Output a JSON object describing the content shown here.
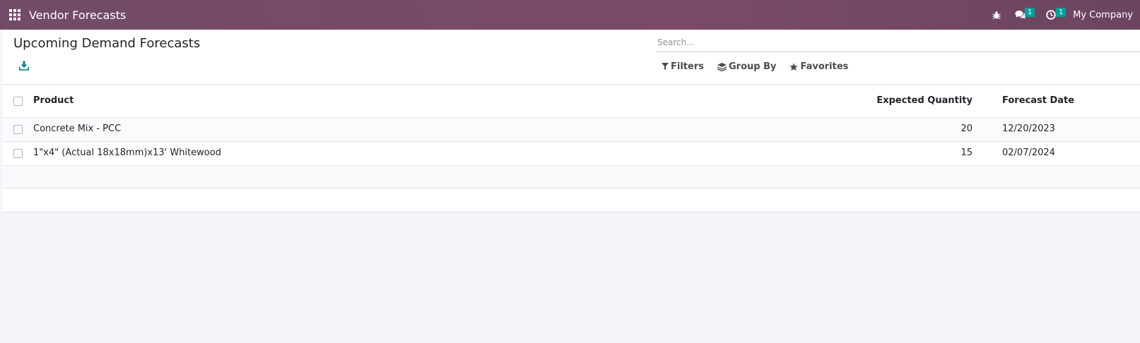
{
  "navbar": {
    "app_title": "Vendor Forecasts",
    "messages_count": "1",
    "activities_count": "1",
    "company": "My Company",
    "accent_color": "#714b67",
    "icons": [
      "apps-grid-icon",
      "bug-icon",
      "chat-icon",
      "clock-icon"
    ]
  },
  "page": {
    "title": "Upcoming Demand Forecasts",
    "download_icon": "download-icon"
  },
  "search": {
    "placeholder": "Search...",
    "value": ""
  },
  "filters": {
    "filters_label": "Filters",
    "group_by_label": "Group By",
    "favorites_label": "Favorites"
  },
  "table": {
    "columns": [
      "Product",
      "Expected Quantity",
      "Forecast Date"
    ],
    "rows": [
      {
        "product": "Concrete Mix - PCC",
        "quantity": "20",
        "date": "12/20/2023"
      },
      {
        "product": "1\"x4\" (Actual 18x18mm)x13' Whitewood",
        "quantity": "15",
        "date": "02/07/2024"
      }
    ]
  }
}
